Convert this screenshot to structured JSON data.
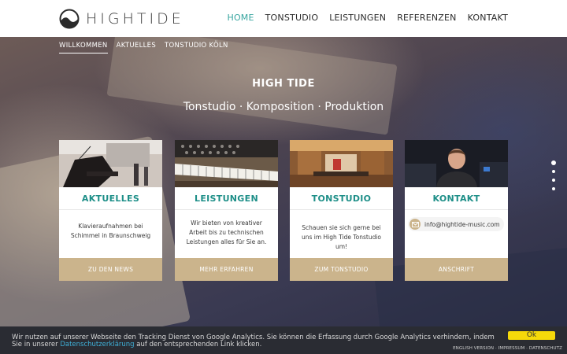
{
  "header": {
    "logo_text": "HIGHTIDE",
    "nav": [
      {
        "label": "HOME",
        "active": true
      },
      {
        "label": "TONSTUDIO"
      },
      {
        "label": "LEISTUNGEN"
      },
      {
        "label": "REFERENZEN"
      },
      {
        "label": "KONTAKT"
      }
    ]
  },
  "subnav": [
    {
      "label": "WILLKOMMEN",
      "active": true
    },
    {
      "label": "AKTUELLES"
    },
    {
      "label": "TONSTUDIO KÖLN"
    }
  ],
  "hero": {
    "title": "HIGH TIDE",
    "subtitle": "Tonstudio · Komposition · Produktion"
  },
  "cards": [
    {
      "title": "AKTUELLES",
      "text": "Klavieraufnahmen bei Schimmel in Braunschweig",
      "button": "ZU DEN NEWS"
    },
    {
      "title": "LEISTUNGEN",
      "text": "Wir bieten von kreativer Arbeit bis zu technischen Leistungen alles für Sie an.",
      "button": "MEHR ERFAHREN"
    },
    {
      "title": "TONSTUDIO",
      "text": "Schauen sie sich gerne bei uns im High Tide Tonstudio um!",
      "button": "ZUM TONSTUDIO"
    },
    {
      "title": "KONTAKT",
      "email": "info@hightide-music.com",
      "button": "ANSCHRIFT"
    }
  ],
  "cookie": {
    "text_before": "Wir nutzen auf unserer Webseite den Tracking Dienst von Google Analytics. Sie können die Erfassung durch Google Analytics verhindern, indem Sie in unserer ",
    "link": "Datenschutzerklärung",
    "text_after": " auf den entsprechenden Link klicken.",
    "ok": "Ok"
  },
  "footer": {
    "links": [
      "ENGLISH VERSION",
      "IMPRESSUM",
      "DATENSCHUTZ"
    ],
    "separator": " · "
  },
  "colors": {
    "accent": "#39a6a0",
    "card_title": "#1e8f88",
    "button": "#cbb48c",
    "ok": "#f5d90a"
  }
}
